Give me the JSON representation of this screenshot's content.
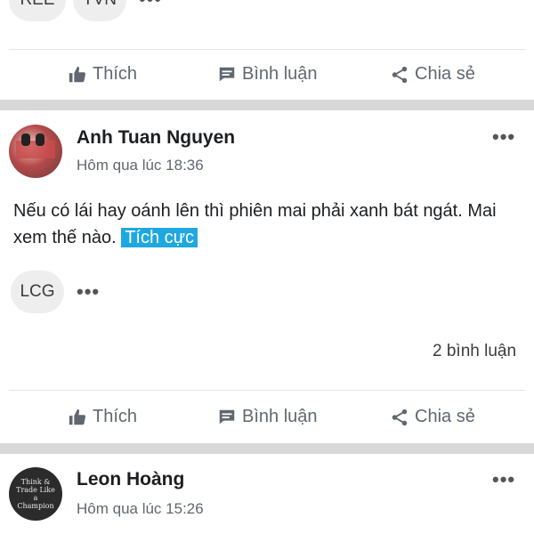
{
  "top_tags": [
    "REE",
    "TVN"
  ],
  "actions": {
    "like": "Thích",
    "comment": "Bình luận",
    "share": "Chia sẻ"
  },
  "posts": [
    {
      "author": "Anh Tuan Nguyen",
      "time": "Hôm qua lúc 18:36",
      "text_before": "Nếu có lái hay oánh lên thì phiên mai phải xanh bát ngát. Mai xem thế nào.",
      "tag": "Tích cực",
      "tickers": [
        "LCG"
      ],
      "comments": "2 bình luận"
    },
    {
      "author": "Leon Hoàng",
      "time": "Hôm qua lúc 15:26",
      "avatar_text": "Think & Trade Like a Champion"
    }
  ],
  "colors": {
    "highlight": "#1fa8e0",
    "divider": "#d8d8d8"
  }
}
